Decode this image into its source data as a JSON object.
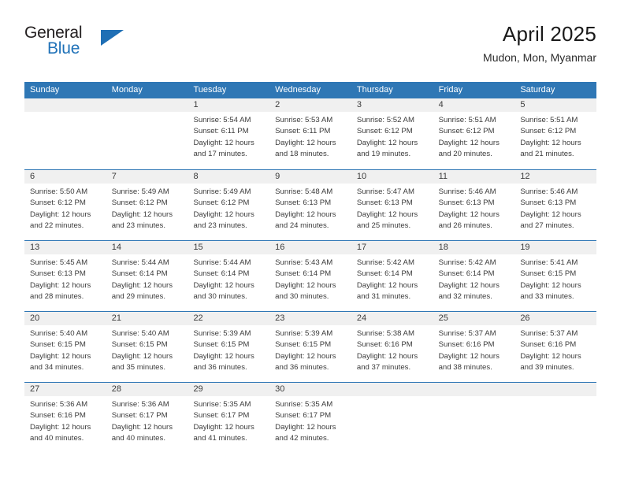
{
  "brand": {
    "name_top": "General",
    "name_bottom": "Blue",
    "triangle_icon": "blue-triangle-logo",
    "color_dark": "#231f20",
    "color_blue": "#2072b8"
  },
  "header": {
    "title": "April 2025",
    "subtitle": "Mudon, Mon, Myanmar"
  },
  "theme": {
    "header_bg": "#2f77b5",
    "header_text": "#ffffff",
    "day_band_bg": "#f0f0f0",
    "row_rule": "#2f77b5",
    "body_text": "#3b3b3b"
  },
  "calendar": {
    "weekdays": [
      "Sunday",
      "Monday",
      "Tuesday",
      "Wednesday",
      "Thursday",
      "Friday",
      "Saturday"
    ],
    "weeks": [
      [
        {
          "day": ""
        },
        {
          "day": ""
        },
        {
          "day": "1",
          "sunrise": "Sunrise: 5:54 AM",
          "sunset": "Sunset: 6:11 PM",
          "daylight1": "Daylight: 12 hours",
          "daylight2": "and 17 minutes."
        },
        {
          "day": "2",
          "sunrise": "Sunrise: 5:53 AM",
          "sunset": "Sunset: 6:11 PM",
          "daylight1": "Daylight: 12 hours",
          "daylight2": "and 18 minutes."
        },
        {
          "day": "3",
          "sunrise": "Sunrise: 5:52 AM",
          "sunset": "Sunset: 6:12 PM",
          "daylight1": "Daylight: 12 hours",
          "daylight2": "and 19 minutes."
        },
        {
          "day": "4",
          "sunrise": "Sunrise: 5:51 AM",
          "sunset": "Sunset: 6:12 PM",
          "daylight1": "Daylight: 12 hours",
          "daylight2": "and 20 minutes."
        },
        {
          "day": "5",
          "sunrise": "Sunrise: 5:51 AM",
          "sunset": "Sunset: 6:12 PM",
          "daylight1": "Daylight: 12 hours",
          "daylight2": "and 21 minutes."
        }
      ],
      [
        {
          "day": "6",
          "sunrise": "Sunrise: 5:50 AM",
          "sunset": "Sunset: 6:12 PM",
          "daylight1": "Daylight: 12 hours",
          "daylight2": "and 22 minutes."
        },
        {
          "day": "7",
          "sunrise": "Sunrise: 5:49 AM",
          "sunset": "Sunset: 6:12 PM",
          "daylight1": "Daylight: 12 hours",
          "daylight2": "and 23 minutes."
        },
        {
          "day": "8",
          "sunrise": "Sunrise: 5:49 AM",
          "sunset": "Sunset: 6:12 PM",
          "daylight1": "Daylight: 12 hours",
          "daylight2": "and 23 minutes."
        },
        {
          "day": "9",
          "sunrise": "Sunrise: 5:48 AM",
          "sunset": "Sunset: 6:13 PM",
          "daylight1": "Daylight: 12 hours",
          "daylight2": "and 24 minutes."
        },
        {
          "day": "10",
          "sunrise": "Sunrise: 5:47 AM",
          "sunset": "Sunset: 6:13 PM",
          "daylight1": "Daylight: 12 hours",
          "daylight2": "and 25 minutes."
        },
        {
          "day": "11",
          "sunrise": "Sunrise: 5:46 AM",
          "sunset": "Sunset: 6:13 PM",
          "daylight1": "Daylight: 12 hours",
          "daylight2": "and 26 minutes."
        },
        {
          "day": "12",
          "sunrise": "Sunrise: 5:46 AM",
          "sunset": "Sunset: 6:13 PM",
          "daylight1": "Daylight: 12 hours",
          "daylight2": "and 27 minutes."
        }
      ],
      [
        {
          "day": "13",
          "sunrise": "Sunrise: 5:45 AM",
          "sunset": "Sunset: 6:13 PM",
          "daylight1": "Daylight: 12 hours",
          "daylight2": "and 28 minutes."
        },
        {
          "day": "14",
          "sunrise": "Sunrise: 5:44 AM",
          "sunset": "Sunset: 6:14 PM",
          "daylight1": "Daylight: 12 hours",
          "daylight2": "and 29 minutes."
        },
        {
          "day": "15",
          "sunrise": "Sunrise: 5:44 AM",
          "sunset": "Sunset: 6:14 PM",
          "daylight1": "Daylight: 12 hours",
          "daylight2": "and 30 minutes."
        },
        {
          "day": "16",
          "sunrise": "Sunrise: 5:43 AM",
          "sunset": "Sunset: 6:14 PM",
          "daylight1": "Daylight: 12 hours",
          "daylight2": "and 30 minutes."
        },
        {
          "day": "17",
          "sunrise": "Sunrise: 5:42 AM",
          "sunset": "Sunset: 6:14 PM",
          "daylight1": "Daylight: 12 hours",
          "daylight2": "and 31 minutes."
        },
        {
          "day": "18",
          "sunrise": "Sunrise: 5:42 AM",
          "sunset": "Sunset: 6:14 PM",
          "daylight1": "Daylight: 12 hours",
          "daylight2": "and 32 minutes."
        },
        {
          "day": "19",
          "sunrise": "Sunrise: 5:41 AM",
          "sunset": "Sunset: 6:15 PM",
          "daylight1": "Daylight: 12 hours",
          "daylight2": "and 33 minutes."
        }
      ],
      [
        {
          "day": "20",
          "sunrise": "Sunrise: 5:40 AM",
          "sunset": "Sunset: 6:15 PM",
          "daylight1": "Daylight: 12 hours",
          "daylight2": "and 34 minutes."
        },
        {
          "day": "21",
          "sunrise": "Sunrise: 5:40 AM",
          "sunset": "Sunset: 6:15 PM",
          "daylight1": "Daylight: 12 hours",
          "daylight2": "and 35 minutes."
        },
        {
          "day": "22",
          "sunrise": "Sunrise: 5:39 AM",
          "sunset": "Sunset: 6:15 PM",
          "daylight1": "Daylight: 12 hours",
          "daylight2": "and 36 minutes."
        },
        {
          "day": "23",
          "sunrise": "Sunrise: 5:39 AM",
          "sunset": "Sunset: 6:15 PM",
          "daylight1": "Daylight: 12 hours",
          "daylight2": "and 36 minutes."
        },
        {
          "day": "24",
          "sunrise": "Sunrise: 5:38 AM",
          "sunset": "Sunset: 6:16 PM",
          "daylight1": "Daylight: 12 hours",
          "daylight2": "and 37 minutes."
        },
        {
          "day": "25",
          "sunrise": "Sunrise: 5:37 AM",
          "sunset": "Sunset: 6:16 PM",
          "daylight1": "Daylight: 12 hours",
          "daylight2": "and 38 minutes."
        },
        {
          "day": "26",
          "sunrise": "Sunrise: 5:37 AM",
          "sunset": "Sunset: 6:16 PM",
          "daylight1": "Daylight: 12 hours",
          "daylight2": "and 39 minutes."
        }
      ],
      [
        {
          "day": "27",
          "sunrise": "Sunrise: 5:36 AM",
          "sunset": "Sunset: 6:16 PM",
          "daylight1": "Daylight: 12 hours",
          "daylight2": "and 40 minutes."
        },
        {
          "day": "28",
          "sunrise": "Sunrise: 5:36 AM",
          "sunset": "Sunset: 6:17 PM",
          "daylight1": "Daylight: 12 hours",
          "daylight2": "and 40 minutes."
        },
        {
          "day": "29",
          "sunrise": "Sunrise: 5:35 AM",
          "sunset": "Sunset: 6:17 PM",
          "daylight1": "Daylight: 12 hours",
          "daylight2": "and 41 minutes."
        },
        {
          "day": "30",
          "sunrise": "Sunrise: 5:35 AM",
          "sunset": "Sunset: 6:17 PM",
          "daylight1": "Daylight: 12 hours",
          "daylight2": "and 42 minutes."
        },
        {
          "day": ""
        },
        {
          "day": ""
        },
        {
          "day": ""
        }
      ]
    ]
  }
}
